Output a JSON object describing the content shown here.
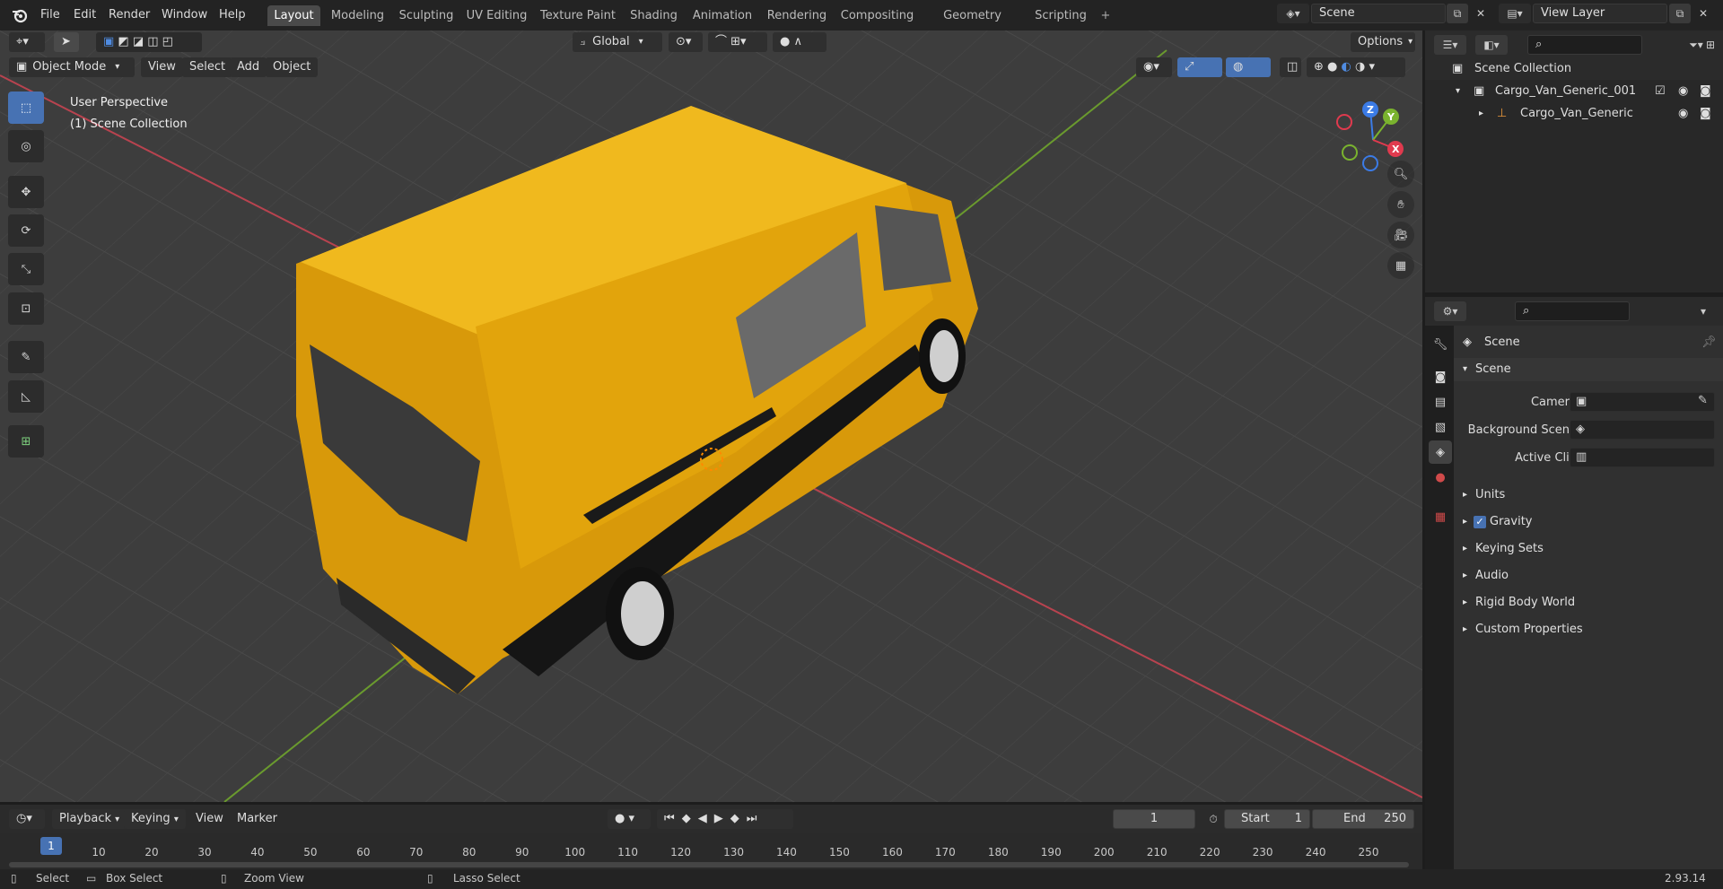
{
  "menus": [
    "File",
    "Edit",
    "Render",
    "Window",
    "Help"
  ],
  "workspaces": [
    "Layout",
    "Modeling",
    "Sculpting",
    "UV Editing",
    "Texture Paint",
    "Shading",
    "Animation",
    "Rendering",
    "Compositing",
    "Geometry Nodes",
    "Scripting"
  ],
  "active_workspace": "Layout",
  "scene_field": "Scene",
  "view_layer_field": "View Layer",
  "viewport": {
    "transform_orientation": "Global",
    "options_label": "Options",
    "mode": "Object Mode",
    "menus": [
      "View",
      "Select",
      "Add",
      "Object"
    ],
    "overlay_line1": "User Perspective",
    "overlay_line2": "(1) Scene Collection",
    "gizmo_axes": {
      "x": "X",
      "y": "Y",
      "z": "Z"
    },
    "tools": [
      "select-box",
      "cursor",
      "move",
      "rotate",
      "scale",
      "transform",
      "annotate",
      "measure",
      "add-cube"
    ]
  },
  "outliner": {
    "root": "Scene Collection",
    "items": [
      {
        "label": "Cargo_Van_Generic_001",
        "level": 1
      },
      {
        "label": "Cargo_Van_Generic",
        "level": 2
      }
    ]
  },
  "properties": {
    "context_title": "Scene",
    "panel_title": "Scene",
    "fields": [
      {
        "label": "Camera"
      },
      {
        "label": "Background Scene"
      },
      {
        "label": "Active Clip"
      }
    ],
    "sections": [
      "Units",
      "Gravity",
      "Keying Sets",
      "Audio",
      "Rigid Body World",
      "Custom Properties"
    ],
    "gravity_checked": true
  },
  "timeline": {
    "menus": [
      "Playback",
      "Keying",
      "View",
      "Marker"
    ],
    "current_frame": "1",
    "start_label": "Start",
    "start_value": "1",
    "end_label": "End",
    "end_value": "250",
    "ruler": [
      "1",
      "10",
      "20",
      "30",
      "40",
      "50",
      "60",
      "70",
      "80",
      "90",
      "100",
      "110",
      "120",
      "130",
      "140",
      "150",
      "160",
      "170",
      "180",
      "190",
      "200",
      "210",
      "220",
      "230",
      "240",
      "250"
    ]
  },
  "statusbar": {
    "items": [
      "Select",
      "Box Select",
      "Zoom View",
      "Lasso Select"
    ],
    "version": "2.93.14"
  },
  "colors": {
    "accent": "#4772b3",
    "van_body": "#e2a40c",
    "x_axis": "#b8434f",
    "y_axis": "#6a9a2e",
    "gizmo_x": "#e03a4e",
    "gizmo_y": "#7ab32e",
    "gizmo_z": "#3b7be6"
  }
}
